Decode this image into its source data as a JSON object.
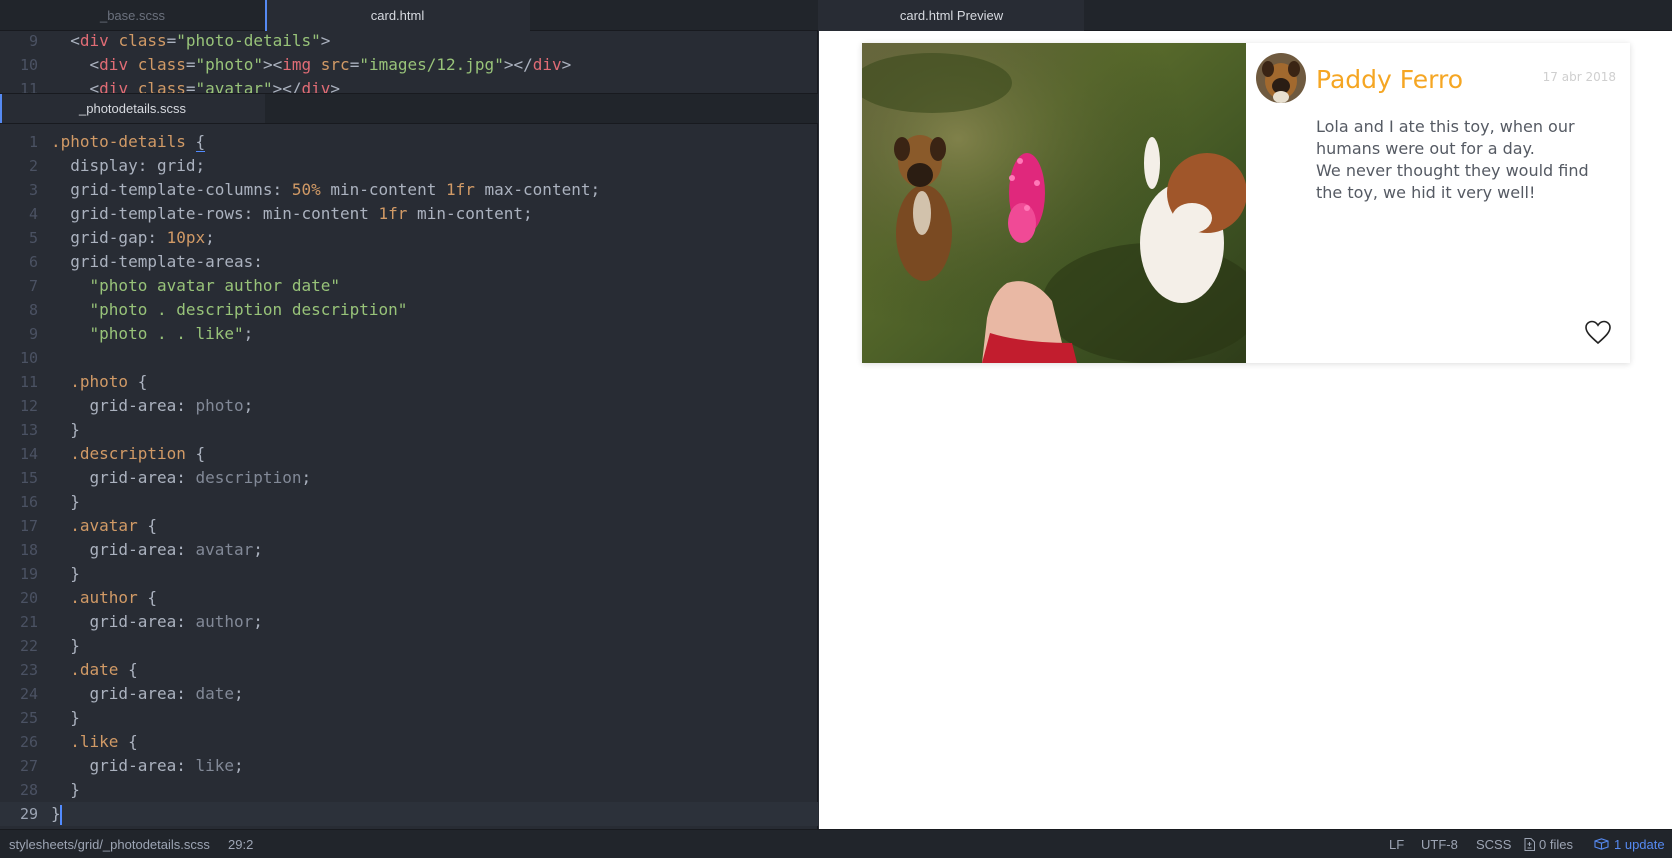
{
  "tabs": {
    "top": [
      {
        "label": "_base.scss",
        "active": false
      },
      {
        "label": "card.html",
        "active": true
      }
    ],
    "split": {
      "label": "_photodetails.scss"
    },
    "preview": {
      "label": "card.html Preview"
    }
  },
  "top_editor": {
    "lines": [
      {
        "n": "9",
        "tokens": [
          {
            "t": "  ",
            "c": ""
          },
          {
            "t": "<",
            "c": "punc"
          },
          {
            "t": "div",
            "c": "tag"
          },
          {
            "t": " ",
            "c": ""
          },
          {
            "t": "class",
            "c": "attr"
          },
          {
            "t": "=",
            "c": "punc"
          },
          {
            "t": "\"photo-details\"",
            "c": "str"
          },
          {
            "t": ">",
            "c": "punc"
          }
        ]
      },
      {
        "n": "10",
        "tokens": [
          {
            "t": "    ",
            "c": ""
          },
          {
            "t": "<",
            "c": "punc"
          },
          {
            "t": "div",
            "c": "tag"
          },
          {
            "t": " ",
            "c": ""
          },
          {
            "t": "class",
            "c": "attr"
          },
          {
            "t": "=",
            "c": "punc"
          },
          {
            "t": "\"photo\"",
            "c": "str"
          },
          {
            "t": "><",
            "c": "punc"
          },
          {
            "t": "img",
            "c": "tag"
          },
          {
            "t": " ",
            "c": ""
          },
          {
            "t": "src",
            "c": "attr"
          },
          {
            "t": "=",
            "c": "punc"
          },
          {
            "t": "\"images/12.jpg\"",
            "c": "str"
          },
          {
            "t": "></",
            "c": "punc"
          },
          {
            "t": "div",
            "c": "tag"
          },
          {
            "t": ">",
            "c": "punc"
          }
        ]
      },
      {
        "n": "11",
        "tokens": [
          {
            "t": "    ",
            "c": ""
          },
          {
            "t": "<",
            "c": "punc"
          },
          {
            "t": "div",
            "c": "tag"
          },
          {
            "t": " ",
            "c": ""
          },
          {
            "t": "class",
            "c": "attr"
          },
          {
            "t": "=",
            "c": "punc"
          },
          {
            "t": "\"avatar\"",
            "c": "str"
          },
          {
            "t": "></",
            "c": "punc"
          },
          {
            "t": "div",
            "c": "tag"
          },
          {
            "t": ">",
            "c": "punc"
          }
        ]
      }
    ]
  },
  "bottom_editor": {
    "lines": [
      {
        "n": "1",
        "tokens": [
          {
            "t": ".photo-details",
            "c": "sel"
          },
          {
            "t": " ",
            "c": ""
          },
          {
            "t": "{",
            "c": "bracehl"
          }
        ]
      },
      {
        "n": "2",
        "tokens": [
          {
            "t": "  display: grid;",
            "c": "prop"
          }
        ]
      },
      {
        "n": "3",
        "tokens": [
          {
            "t": "  grid-template-columns: ",
            "c": "prop"
          },
          {
            "t": "50%",
            "c": "num"
          },
          {
            "t": " min-content ",
            "c": "prop"
          },
          {
            "t": "1fr",
            "c": "num"
          },
          {
            "t": " max-content;",
            "c": "prop"
          }
        ]
      },
      {
        "n": "4",
        "tokens": [
          {
            "t": "  grid-template-rows: min-content ",
            "c": "prop"
          },
          {
            "t": "1fr",
            "c": "num"
          },
          {
            "t": " min-content;",
            "c": "prop"
          }
        ]
      },
      {
        "n": "5",
        "tokens": [
          {
            "t": "  grid-gap: ",
            "c": "prop"
          },
          {
            "t": "10px",
            "c": "num"
          },
          {
            "t": ";",
            "c": "prop"
          }
        ]
      },
      {
        "n": "6",
        "tokens": [
          {
            "t": "  grid-template-areas:",
            "c": "prop"
          }
        ]
      },
      {
        "n": "7",
        "tokens": [
          {
            "t": "    ",
            "c": ""
          },
          {
            "t": "\"photo avatar author date\"",
            "c": "str"
          }
        ]
      },
      {
        "n": "8",
        "tokens": [
          {
            "t": "    ",
            "c": ""
          },
          {
            "t": "\"photo . description description\"",
            "c": "str"
          }
        ]
      },
      {
        "n": "9",
        "tokens": [
          {
            "t": "    ",
            "c": ""
          },
          {
            "t": "\"photo . . like\"",
            "c": "str"
          },
          {
            "t": ";",
            "c": "prop"
          }
        ]
      },
      {
        "n": "10",
        "tokens": []
      },
      {
        "n": "11",
        "tokens": [
          {
            "t": "  ",
            "c": ""
          },
          {
            "t": ".photo",
            "c": "sel"
          },
          {
            "t": " {",
            "c": "prop"
          }
        ]
      },
      {
        "n": "12",
        "tokens": [
          {
            "t": "    grid-area: ",
            "c": "prop"
          },
          {
            "t": "photo",
            "c": "val"
          },
          {
            "t": ";",
            "c": "prop"
          }
        ]
      },
      {
        "n": "13",
        "tokens": [
          {
            "t": "  }",
            "c": "prop"
          }
        ]
      },
      {
        "n": "14",
        "tokens": [
          {
            "t": "  ",
            "c": ""
          },
          {
            "t": ".description",
            "c": "sel"
          },
          {
            "t": " {",
            "c": "prop"
          }
        ]
      },
      {
        "n": "15",
        "tokens": [
          {
            "t": "    grid-area: ",
            "c": "prop"
          },
          {
            "t": "description",
            "c": "val"
          },
          {
            "t": ";",
            "c": "prop"
          }
        ]
      },
      {
        "n": "16",
        "tokens": [
          {
            "t": "  }",
            "c": "prop"
          }
        ]
      },
      {
        "n": "17",
        "tokens": [
          {
            "t": "  ",
            "c": ""
          },
          {
            "t": ".avatar",
            "c": "sel"
          },
          {
            "t": " {",
            "c": "prop"
          }
        ]
      },
      {
        "n": "18",
        "tokens": [
          {
            "t": "    grid-area: ",
            "c": "prop"
          },
          {
            "t": "avatar",
            "c": "val"
          },
          {
            "t": ";",
            "c": "prop"
          }
        ]
      },
      {
        "n": "19",
        "tokens": [
          {
            "t": "  }",
            "c": "prop"
          }
        ]
      },
      {
        "n": "20",
        "tokens": [
          {
            "t": "  ",
            "c": ""
          },
          {
            "t": ".author",
            "c": "sel"
          },
          {
            "t": " {",
            "c": "prop"
          }
        ]
      },
      {
        "n": "21",
        "tokens": [
          {
            "t": "    grid-area: ",
            "c": "prop"
          },
          {
            "t": "author",
            "c": "val"
          },
          {
            "t": ";",
            "c": "prop"
          }
        ]
      },
      {
        "n": "22",
        "tokens": [
          {
            "t": "  }",
            "c": "prop"
          }
        ]
      },
      {
        "n": "23",
        "tokens": [
          {
            "t": "  ",
            "c": ""
          },
          {
            "t": ".date",
            "c": "sel"
          },
          {
            "t": " {",
            "c": "prop"
          }
        ]
      },
      {
        "n": "24",
        "tokens": [
          {
            "t": "    grid-area: ",
            "c": "prop"
          },
          {
            "t": "date",
            "c": "val"
          },
          {
            "t": ";",
            "c": "prop"
          }
        ]
      },
      {
        "n": "25",
        "tokens": [
          {
            "t": "  }",
            "c": "prop"
          }
        ]
      },
      {
        "n": "26",
        "tokens": [
          {
            "t": "  ",
            "c": ""
          },
          {
            "t": ".like",
            "c": "sel"
          },
          {
            "t": " {",
            "c": "prop"
          }
        ]
      },
      {
        "n": "27",
        "tokens": [
          {
            "t": "    grid-area: ",
            "c": "prop"
          },
          {
            "t": "like",
            "c": "val"
          },
          {
            "t": ";",
            "c": "prop"
          }
        ]
      },
      {
        "n": "28",
        "tokens": [
          {
            "t": "  }",
            "c": "prop"
          }
        ]
      },
      {
        "n": "29",
        "tokens": [
          {
            "t": "}",
            "c": "cursorbrace"
          }
        ],
        "current": true
      }
    ]
  },
  "preview": {
    "author": "Paddy Ferro",
    "date": "17 abr 2018",
    "description": [
      "Lola and I ate this toy, when our humans were out for a day.",
      "We never thought they would find the toy, we hid it very well!"
    ],
    "photo_icon": "photo-of-dogs-with-pink-toy",
    "avatar_icon": "dog-avatar",
    "like_icon": "heart-icon",
    "colors": {
      "author": "#f5a623",
      "text": "#555a63",
      "date": "#cfcfcf"
    }
  },
  "statusbar": {
    "file_path": "stylesheets/grid/_photodetails.scss",
    "cursor_pos": "29:2",
    "line_ending": "LF",
    "encoding": "UTF-8",
    "grammar": "SCSS",
    "git_files": "0 files",
    "updates": "1 update"
  }
}
